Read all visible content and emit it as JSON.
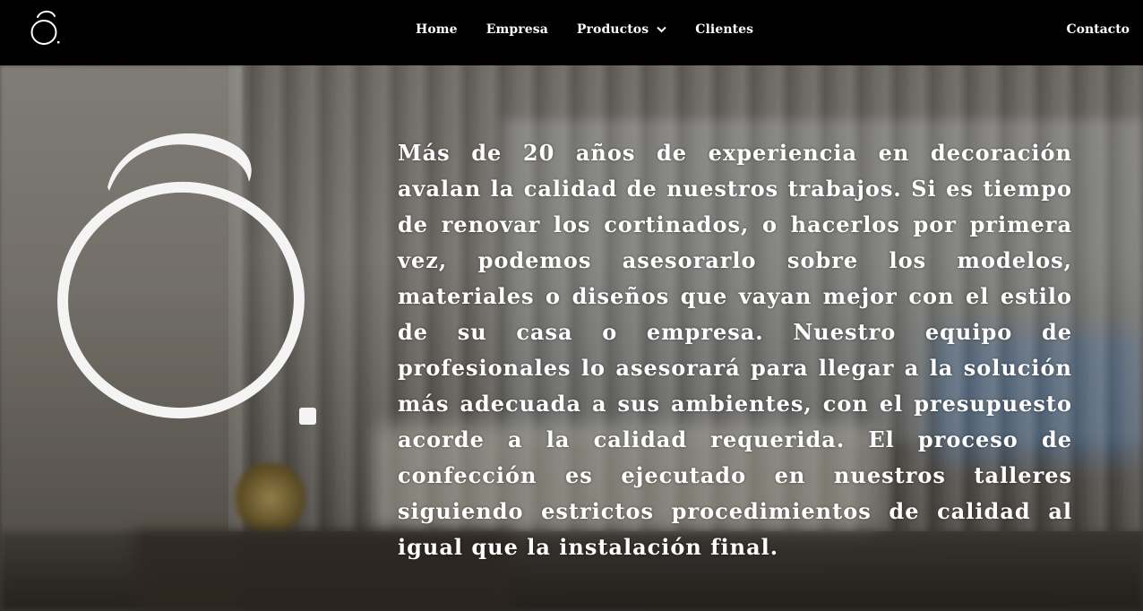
{
  "nav": {
    "logo_icon": "brand-logo-icon",
    "items": [
      {
        "label": "Home"
      },
      {
        "label": "Empresa"
      },
      {
        "label": "Productos",
        "icon": "chevron-down-icon"
      },
      {
        "label": "Clientes"
      }
    ],
    "contact_label": "Contacto"
  },
  "hero": {
    "logo_icon": "brand-logo-large-icon",
    "paragraph": "Más de 20 años de experiencia en decoración avalan la calidad de nuestros trabajos. Si es tiempo de renovar los cortinados, o hacerlos por primera vez, podemos asesorarlo sobre los modelos, materiales o diseños que vayan mejor con el estilo de su casa o empresa. Nuestro equipo de profesionales lo asesorará para llegar a la solución más adecuada a sus ambientes, con el presupuesto acorde a la calidad requerida. El proceso de confección es ejecutado en nuestros talleres siguiendo estrictos procedimientos de calidad al igual que la instalación final."
  },
  "colors": {
    "nav_background": "#000000",
    "text": "#ffffff"
  }
}
